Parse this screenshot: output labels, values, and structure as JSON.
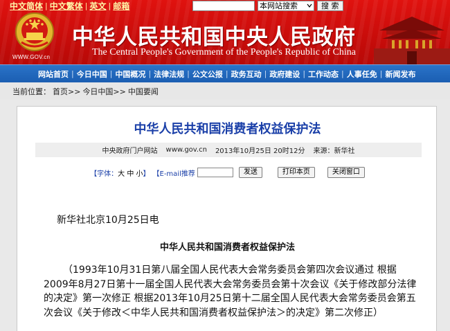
{
  "lang_links": [
    "中文简体",
    "中文繁体",
    "英文",
    "邮箱"
  ],
  "search": {
    "select_value": "本网站搜索",
    "button_label": "搜 索"
  },
  "header": {
    "site_url": "WWW.GOV.cn",
    "title_cn": "中华人民共和国中央人民政府",
    "title_en": "The Central People's Government of the People's Republic of China"
  },
  "nav": [
    "网站首页",
    "今日中国",
    "中国概况",
    "法律法规",
    "公文公报",
    "政务互动",
    "政府建设",
    "工作动态",
    "人事任免",
    "新闻发布"
  ],
  "breadcrumb": {
    "prefix": "当前位置：",
    "items": [
      "首页>>",
      "今日中国>>",
      "中国要闻"
    ]
  },
  "article": {
    "title": "中华人民共和国消费者权益保护法",
    "meta": {
      "source_site": "中央政府门户网站",
      "url": "www.gov.cn",
      "datetime": "2013年10月25日 20时12分",
      "source_label": "来源：新华社"
    },
    "tools": {
      "font_label": "【字体：",
      "font_sizes": [
        "大",
        "中",
        "小"
      ],
      "font_close": "】",
      "email_label": "【E-mail推荐",
      "send_button": "发送",
      "print_button": "打印本页",
      "close_button": "关闭窗口"
    },
    "dateline": "新华社北京10月25日电",
    "law_heading": "中华人民共和国消费者权益保护法",
    "preamble": "（1993年10月31日第八届全国人民代表大会常务委员会第四次会议通过 根据2009年8月27日第十一届全国人民代表大会常务委员会第十次会议《关于修改部分法律的决定》第一次修正 根据2013年10月25日第十二届全国人民代表大会常务委员会第五次会议《关于修改＜中华人民共和国消费者权益保护法＞的决定》第二次修正）"
  },
  "colors": {
    "header_red": "#d10f0c",
    "nav_blue": "#1f66bb",
    "title_blue": "#1a3fa8",
    "lang_yellow": "#fff6a8"
  },
  "icons": {
    "emblem": "national-emblem-icon",
    "landmark": "tiananmen-icon",
    "dropdown": "chevron-down-icon"
  }
}
